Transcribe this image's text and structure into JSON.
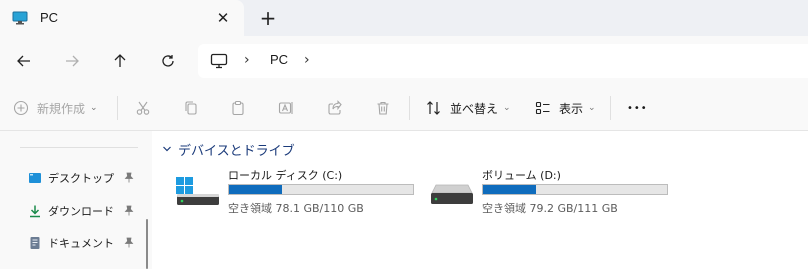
{
  "tab": {
    "title": "PC",
    "close_glyph": "✕",
    "new_tab_glyph": "+"
  },
  "address": {
    "segment": "PC",
    "separator": "›"
  },
  "toolbar": {
    "new_label": "新規作成",
    "sort_label": "並べ替え",
    "view_label": "表示",
    "more_glyph": "•••"
  },
  "icons": {
    "tab": "monitor-icon",
    "back": "arrow-left-icon",
    "forward": "arrow-right-icon",
    "up": "arrow-up-icon",
    "refresh": "refresh-icon",
    "cut": "scissors-icon",
    "copy": "copy-icon",
    "paste": "clipboard-icon",
    "rename": "rename-icon",
    "share": "share-icon",
    "delete": "trash-icon"
  },
  "sidebar": {
    "items": [
      {
        "label": "デスクトップ",
        "icon": "desktop-icon",
        "pinned": true
      },
      {
        "label": "ダウンロード",
        "icon": "download-icon",
        "pinned": true
      },
      {
        "label": "ドキュメント",
        "icon": "document-icon",
        "pinned": true
      }
    ]
  },
  "main": {
    "group_title": "デバイスとドライブ",
    "drives": [
      {
        "name": "ローカル ディスク (C:)",
        "space": "空き領域 78.1 GB/110 GB",
        "used_fraction": 0.29,
        "has_windows_logo": true
      },
      {
        "name": "ボリューム (D:)",
        "space": "空き領域 79.2 GB/111 GB",
        "used_fraction": 0.29,
        "has_windows_logo": false
      }
    ]
  },
  "colors": {
    "accent": "#0f6cbd",
    "group_header": "#1a3a7a",
    "disabled": "#a6a6a6"
  }
}
